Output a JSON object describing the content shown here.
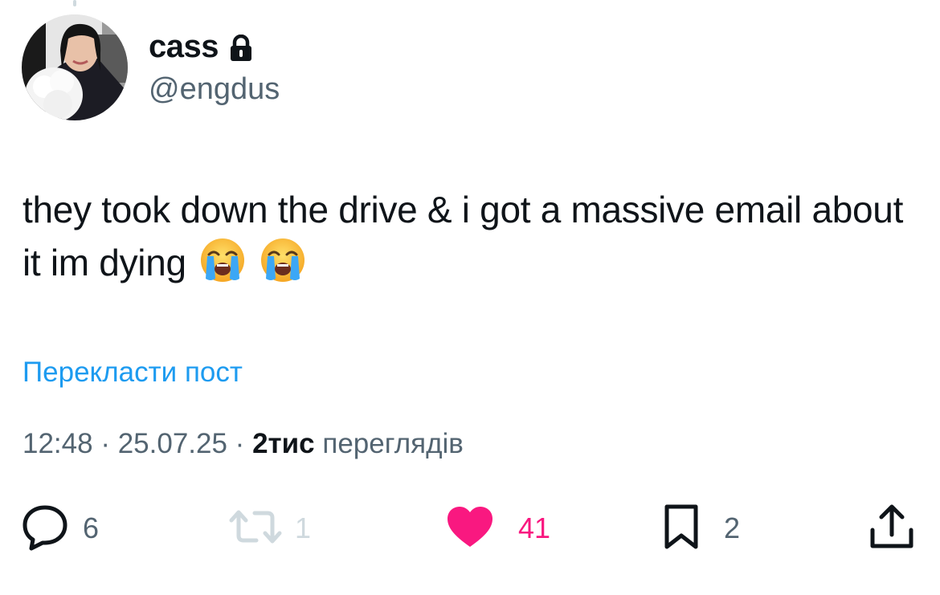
{
  "user": {
    "display_name": "cass",
    "handle": "@engdus",
    "lock_icon": "lock-icon",
    "avatar": "profile-photo"
  },
  "tweet": {
    "text": "they took down the drive & i got a massive email about it im dying",
    "emojis": [
      "loudly-crying-face",
      "loudly-crying-face"
    ]
  },
  "translate_label": "Перекласти пост",
  "meta": {
    "time": "12:48",
    "separator": " · ",
    "date": "25.07.25",
    "views_count": "2тис",
    "views_label": "переглядів"
  },
  "actions": {
    "reply": {
      "icon": "reply-icon",
      "count": "6"
    },
    "retweet": {
      "icon": "retweet-icon",
      "count": "1"
    },
    "like": {
      "icon": "heart-icon",
      "count": "41"
    },
    "bookmark": {
      "icon": "bookmark-icon",
      "count": "2"
    },
    "share": {
      "icon": "share-icon"
    }
  },
  "colors": {
    "link": "#1d9bf0",
    "secondary_text": "#536471",
    "like_active": "#f91880",
    "disabled": "#cfd9de"
  }
}
